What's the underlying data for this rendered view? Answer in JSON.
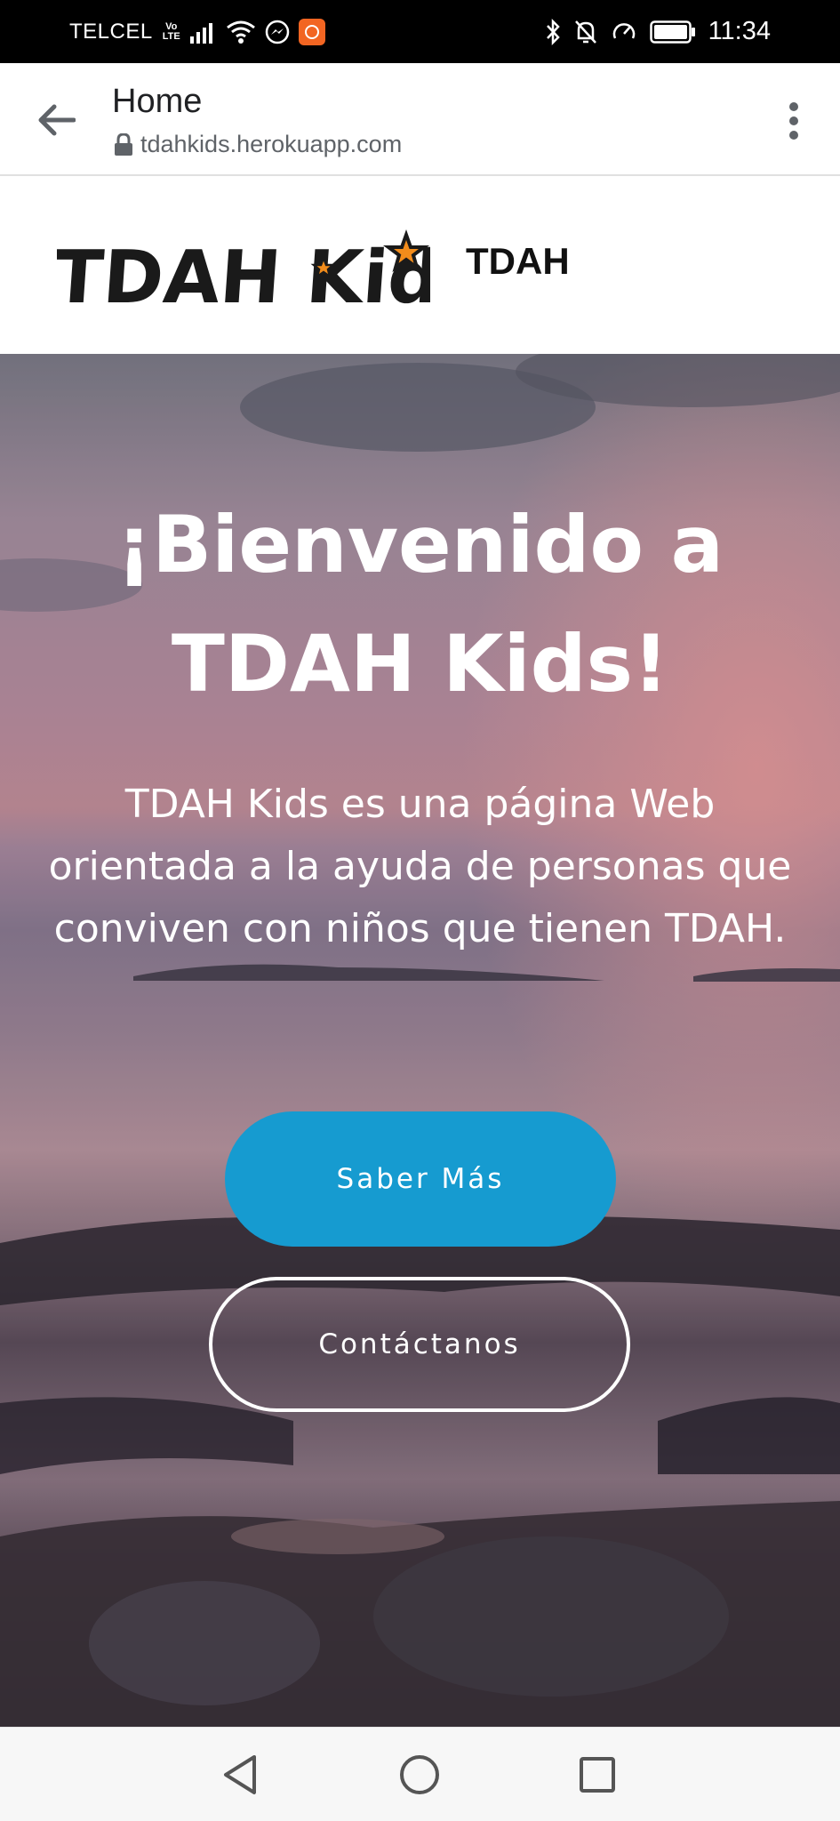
{
  "status_bar": {
    "carrier": "TELCEL",
    "volte": "Vo LTE",
    "time": "11:34",
    "icons": [
      "signal-icon",
      "wifi-icon",
      "messenger-icon",
      "app-badge-icon",
      "bluetooth-icon",
      "mute-icon",
      "data-saver-icon",
      "battery-icon"
    ]
  },
  "browser": {
    "title": "Home",
    "url": "tdahkids.herokuapp.com",
    "icons": [
      "back-arrow-icon",
      "lock-icon",
      "more-vert-icon"
    ]
  },
  "site_header": {
    "logo_text": "TDAH Kids",
    "brand_link": "TDAH",
    "logo_star_color": "#f28c1b"
  },
  "hero": {
    "title": "¡Bienvenido a TDAH Kids!",
    "description": "TDAH Kids es una página Web orientada a la ayuda de personas que conviven con niños que tienen TDAH.",
    "primary_button": "Saber Más",
    "secondary_button": "Contáctanos",
    "primary_color": "#169bd0"
  },
  "nav_bar": {
    "icons": [
      "back-triangle-icon",
      "home-circle-icon",
      "recents-square-icon"
    ]
  }
}
